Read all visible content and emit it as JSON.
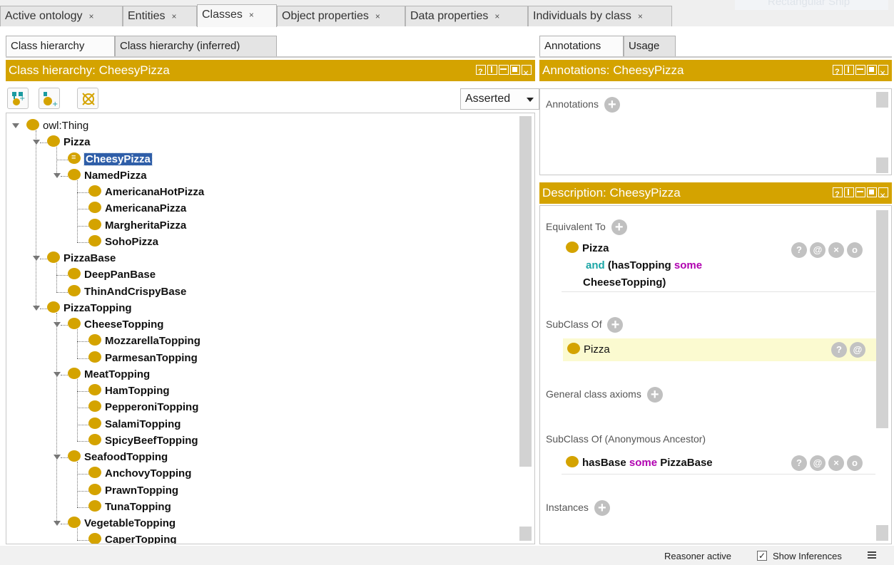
{
  "top_tabs": [
    {
      "label": "Active ontology",
      "active": false
    },
    {
      "label": "Entities",
      "active": false
    },
    {
      "label": "Classes",
      "active": true
    },
    {
      "label": "Object properties",
      "active": false
    },
    {
      "label": "Data properties",
      "active": false
    },
    {
      "label": "Individuals by class",
      "active": false
    }
  ],
  "ghost_text": "Rectangular Snip",
  "left_tabs": [
    "Class hierarchy",
    "Class hierarchy (inferred)"
  ],
  "left_header": "Class hierarchy: CheesyPizza",
  "toolbar": {
    "dropdown_value": "Asserted"
  },
  "tree": [
    {
      "label": "owl:Thing",
      "level": 0,
      "expanded": true,
      "plain": true
    },
    {
      "label": "Pizza",
      "level": 1,
      "expanded": true
    },
    {
      "label": "CheesyPizza",
      "level": 2,
      "leaf": true,
      "selected": true
    },
    {
      "label": "NamedPizza",
      "level": 2,
      "expanded": true
    },
    {
      "label": "AmericanaHotPizza",
      "level": 3,
      "leaf": true
    },
    {
      "label": "AmericanaPizza",
      "level": 3,
      "leaf": true
    },
    {
      "label": "MargheritaPizza",
      "level": 3,
      "leaf": true
    },
    {
      "label": "SohoPizza",
      "level": 3,
      "leaf": true
    },
    {
      "label": "PizzaBase",
      "level": 1,
      "expanded": true
    },
    {
      "label": "DeepPanBase",
      "level": 2,
      "leaf": true
    },
    {
      "label": "ThinAndCrispyBase",
      "level": 2,
      "leaf": true
    },
    {
      "label": "PizzaTopping",
      "level": 1,
      "expanded": true
    },
    {
      "label": "CheeseTopping",
      "level": 2,
      "expanded": true
    },
    {
      "label": "MozzarellaTopping",
      "level": 3,
      "leaf": true
    },
    {
      "label": "ParmesanTopping",
      "level": 3,
      "leaf": true
    },
    {
      "label": "MeatTopping",
      "level": 2,
      "expanded": true
    },
    {
      "label": "HamTopping",
      "level": 3,
      "leaf": true
    },
    {
      "label": "PepperoniTopping",
      "level": 3,
      "leaf": true
    },
    {
      "label": "SalamiTopping",
      "level": 3,
      "leaf": true
    },
    {
      "label": "SpicyBeefTopping",
      "level": 3,
      "leaf": true
    },
    {
      "label": "SeafoodTopping",
      "level": 2,
      "expanded": true
    },
    {
      "label": "AnchovyTopping",
      "level": 3,
      "leaf": true
    },
    {
      "label": "PrawnTopping",
      "level": 3,
      "leaf": true
    },
    {
      "label": "TunaTopping",
      "level": 3,
      "leaf": true
    },
    {
      "label": "VegetableTopping",
      "level": 2,
      "expanded": true
    },
    {
      "label": "CaperTopping",
      "level": 3,
      "leaf": true
    }
  ],
  "right_tabs": [
    "Annotations",
    "Usage"
  ],
  "annotations_header": "Annotations: CheesyPizza",
  "annotations_label": "Annotations",
  "description_header": "Description: CheesyPizza",
  "description": {
    "equivalent_to": "Equivalent To",
    "equiv_line1": "Pizza",
    "equiv_and": "and",
    "equiv_line2": "(hasTopping",
    "equiv_some": "some",
    "equiv_line3": "CheeseTopping)",
    "subclass_of": "SubClass Of",
    "subclass_value": "Pizza",
    "general_axioms": "General class axioms",
    "anon_ancestor": "SubClass Of (Anonymous Ancestor)",
    "anon_prop": "hasBase",
    "anon_some": "some",
    "anon_filler": "PizzaBase",
    "instances": "Instances"
  },
  "status": {
    "reasoner": "Reasoner active",
    "show_inferences": "Show Inferences",
    "show_inferences_checked": true
  },
  "colors": {
    "accent": "#d4a300",
    "selection": "#2f5ea8",
    "keyword_teal": "#1aa6a6",
    "keyword_magenta": "#b000b0"
  }
}
